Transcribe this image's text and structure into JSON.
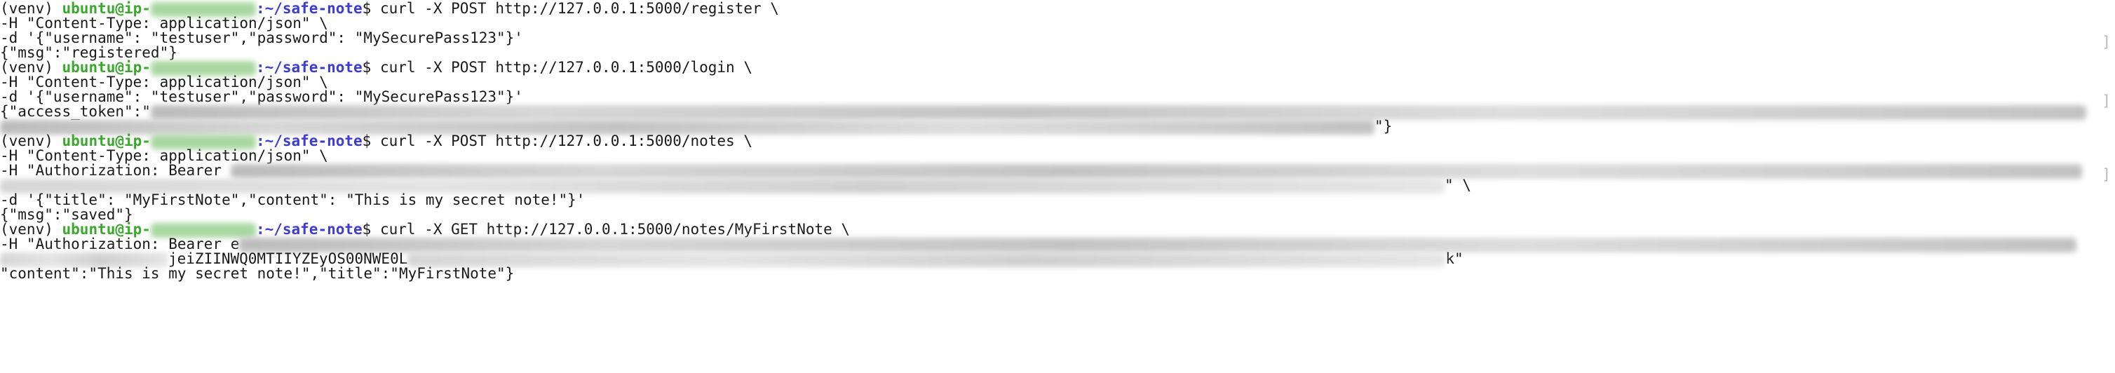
{
  "prompt": {
    "venv": "(venv) ",
    "user_prefix": "ubuntu@ip-",
    "path": ":~/safe-note",
    "dollar": "$ "
  },
  "commands": {
    "register": "curl -X POST http://127.0.0.1:5000/register \\",
    "login": "curl -X POST http://127.0.0.1:5000/login \\",
    "post_notes": "curl -X POST http://127.0.0.1:5000/notes \\",
    "get_note": "curl -X GET http://127.0.0.1:5000/notes/MyFirstNote \\"
  },
  "lines": {
    "content_type": "-H \"Content-Type: application/json\" \\",
    "register_body": "-d '{\"username\": \"testuser\",\"password\": \"MySecurePass123\"}'",
    "register_response": "{\"msg\":\"registered\"}",
    "login_body": "-d '{\"username\": \"testuser\",\"password\": \"MySecurePass123\"}'",
    "token_prefix": "{\"access_token\":\"",
    "token_suffix": "\"}",
    "auth_prefix": "-H \"Authorization: Bearer ",
    "auth_mid_partial": "e",
    "auth_cont_tail": "\" \\",
    "note_body": "-d '{\"title\": \"MyFirstNote\",\"content\": \"This is my secret note!\"}'",
    "saved_response": "{\"msg\":\"saved\"}",
    "get_auth_cont_visible": "jeiZIINWQ0MTIIYZEyOS00NWE0L",
    "get_auth_cont_tail": "k\"",
    "final_response": "\"content\":\"This is my secret note!\",\"title\":\"MyFirstNote\"}"
  },
  "colors": {
    "user": "#3ba82d",
    "path": "#3b3bd6",
    "text": "#1a1a1a"
  }
}
